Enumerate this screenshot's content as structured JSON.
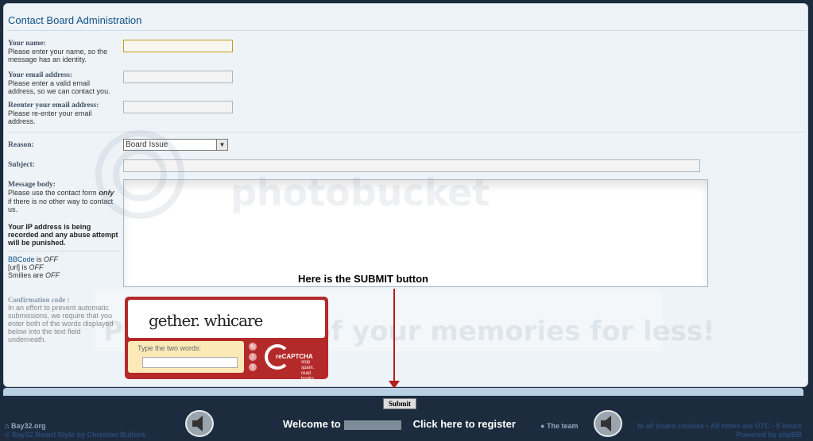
{
  "panel": {
    "title": "Contact Board Administration"
  },
  "form": {
    "name": {
      "label": "Your name:",
      "help": "Please enter your name, so the message has an identity."
    },
    "email": {
      "label": "Your email address:",
      "help": "Please enter a valid email address, so we can contact you."
    },
    "email_confirm": {
      "label": "Reenter your email address:",
      "help": "Please re-enter your email address."
    },
    "reason": {
      "label": "Reason:",
      "selected": "Board Issue"
    },
    "subject": {
      "label": "Subject:"
    },
    "message": {
      "label": "Message body:",
      "help_pre": "Please use the contact form ",
      "help_em": "only",
      "help_post": " if there is no other way to contact us.",
      "warning": "Your IP address is being recorded and any abuse attempt will be punished."
    },
    "options": {
      "bbcode_link": "BBCode",
      "bbcode_rest": " is ",
      "bbcode_state": "OFF",
      "url": "[url] is ",
      "url_state": "OFF",
      "smilies": "Smilies are ",
      "smilies_state": "OFF"
    },
    "confirmation": {
      "label": "Confirmation code :",
      "help": "In an effort to prevent automatic submissions, we require that you enter both of the words displayed below into the text field underneath."
    },
    "captcha": {
      "words": "gether. whicare",
      "input_label": "Type the two words:",
      "brand": "reCAPTCHA",
      "tagline_1": "stop spam.",
      "tagline_2": "read books."
    },
    "submit_label": "Submit"
  },
  "annotation": {
    "text": "Here is the SUBMIT button",
    "color": "#b71c1c"
  },
  "footer": {
    "site": "Bay32.org",
    "credit": "© Bay32 Board Style by Christian Bullock",
    "banner_left": "Welcome to",
    "banner_right": "Click here to register",
    "mid": "The team",
    "right_1": "te all board cookies • All times are UTC - 5 hours",
    "right_2": "Powered by phpBB"
  },
  "watermark": {
    "brand": "photobucket",
    "tagline": "Protect more of your memories for less!"
  },
  "colors": {
    "background": "#1c2c3e",
    "panel": "#eef3f7",
    "title": "#105289",
    "captcha": "#b42a2a"
  }
}
